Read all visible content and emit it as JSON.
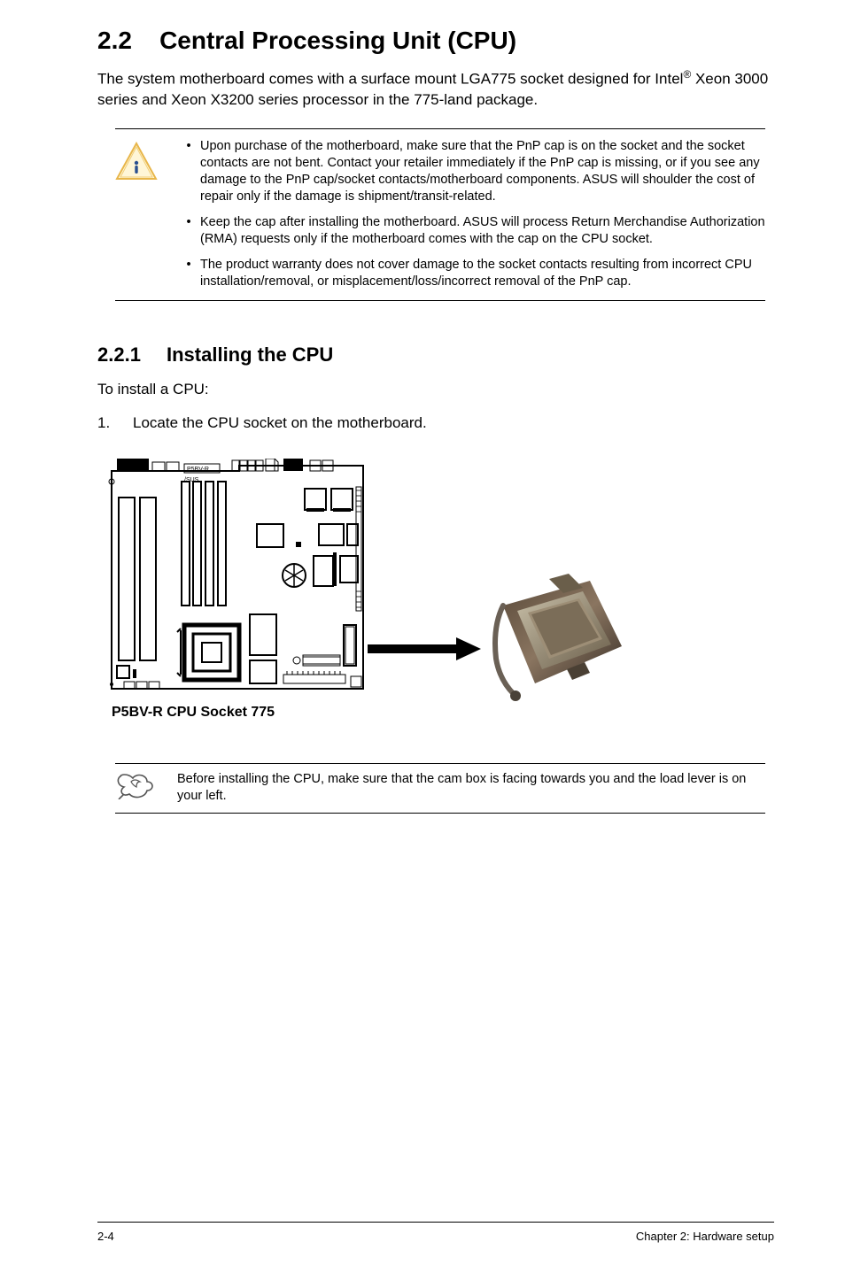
{
  "section": {
    "number": "2.2",
    "title": "Central Processing Unit (CPU)"
  },
  "intro": "The system motherboard comes with a surface mount LGA775 socket designed for Intel® Xeon 3000 series and Xeon X3200 series processor in the 775-land package.",
  "cautions": [
    "Upon purchase of the motherboard, make sure that the PnP cap is on the socket and the socket contacts are not bent. Contact your retailer immediately if the PnP cap is missing, or if you see any damage to the PnP cap/socket contacts/motherboard components. ASUS will shoulder the cost of repair only if the damage is shipment/transit-related.",
    "Keep the cap after installing the motherboard. ASUS will process Return Merchandise Authorization (RMA) requests only if the motherboard comes with the cap on the CPU socket.",
    "The product warranty does not cover damage to the socket contacts resulting from incorrect CPU installation/removal, or misplacement/loss/incorrect removal of the PnP cap."
  ],
  "subsection": {
    "number": "2.2.1",
    "title": "Installing the CPU"
  },
  "body_text": "To install a CPU:",
  "steps": [
    {
      "num": "1.",
      "text": "Locate the CPU socket on the motherboard."
    }
  ],
  "figure": {
    "board_label": "P5BV-R",
    "caption": "P5BV-R CPU Socket 775"
  },
  "note": "Before installing the CPU, make sure that the cam box is facing towards you and the load lever is on your left.",
  "footer": {
    "page": "2-4",
    "chapter": "Chapter 2:  Hardware setup"
  }
}
